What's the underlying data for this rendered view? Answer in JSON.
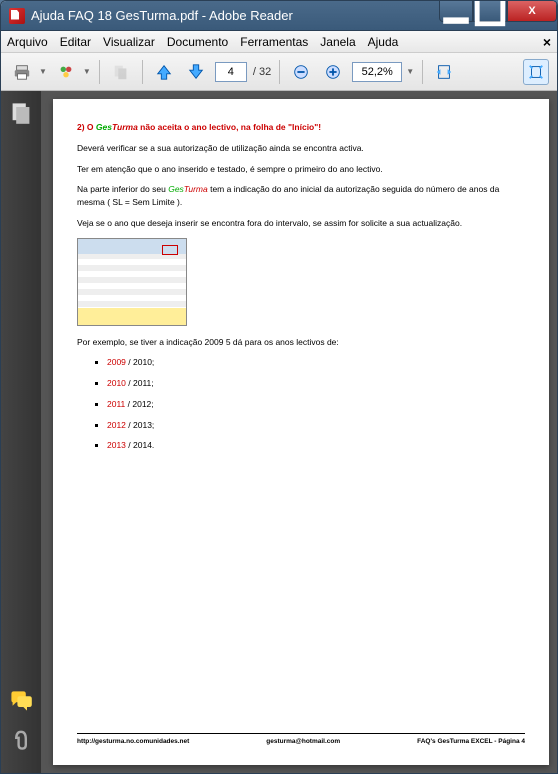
{
  "window": {
    "title": "Ajuda FAQ 18 GesTurma.pdf - Adobe Reader"
  },
  "menu": {
    "arquivo": "Arquivo",
    "editar": "Editar",
    "visualizar": "Visualizar",
    "documento": "Documento",
    "ferramentas": "Ferramentas",
    "janela": "Janela",
    "ajuda": "Ajuda"
  },
  "toolbar": {
    "page": "4",
    "total": "/ 32",
    "zoom": "52,2%"
  },
  "doc": {
    "heading_prefix": "2) O ",
    "heading_ges": "Ges",
    "heading_turma": "Turma",
    "heading_rest": " não aceita o ano lectivo, na folha de \"Início\"!",
    "p1": "Deverá verificar se a sua autorização de utilização ainda se encontra activa.",
    "p2": "Ter em atenção que o ano inserido e testado, é sempre o primeiro do ano lectivo.",
    "p3a": "Na parte inferior do seu ",
    "p3b": " tem a indicação do ano inicial da autorização seguida do número de anos da mesma ( SL = Sem Limite ).",
    "p4": "Veja se o ano que deseja inserir se encontra fora do intervalo, se assim for solicite a sua actualização.",
    "p5": "Por exemplo, se tiver a indicação 2009 5 dá para os anos lectivos de:",
    "items": [
      {
        "y": "2009",
        "r": " / 2010;"
      },
      {
        "y": "2010",
        "r": " / 2011;"
      },
      {
        "y": "2011",
        "r": " / 2012;"
      },
      {
        "y": "2012",
        "r": " / 2013;"
      },
      {
        "y": "2013",
        "r": " / 2014."
      }
    ],
    "footer_left": "http://gesturma.no.comunidades.net",
    "footer_mid": "gesturma@hotmail.com",
    "footer_right": "FAQ's GesTurma EXCEL - Página 4"
  }
}
